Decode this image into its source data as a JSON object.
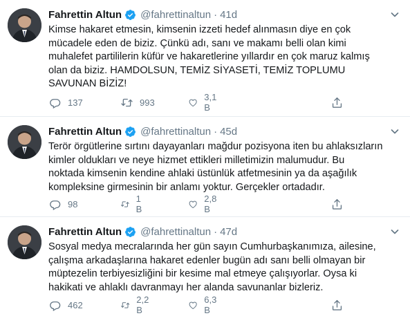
{
  "tweets": [
    {
      "author": "Fahrettin Altun",
      "handle": "@fahrettinaltun",
      "separator": "·",
      "time": "41d",
      "text": "Kimse hakaret etmesin, kimsenin izzeti hedef alınmasın diye en çok\nmücadele eden de biziz. Çünkü adı, sanı ve makamı belli olan kimi\nmuhalefet partililerin küfür ve hakaretlerine yıllardır en çok maruz kalmış\nolan da biziz. HAMDOLSUN, TEMİZ SİYASETİ, TEMİZ TOPLUMU\nSAVUNAN BİZİZ!",
      "replies": "137",
      "retweets": "993",
      "likes": "3,1 B"
    },
    {
      "author": "Fahrettin Altun",
      "handle": "@fahrettinaltun",
      "separator": "·",
      "time": "45d",
      "text": "Terör örgütlerine sırtını dayayanları mağdur pozisyona iten bu ahlaksızların\nkimler oldukları ve neye hizmet ettikleri milletimizin malumudur. Bu\nnoktada kimsenin kendine ahlaki üstünlük atfetmesinin ya da aşağılık\nkompleksine girmesinin bir anlamı yoktur. Gerçekler ortadadır.",
      "replies": "98",
      "retweets": "1 B",
      "likes": "2,8 B"
    },
    {
      "author": "Fahrettin Altun",
      "handle": "@fahrettinaltun",
      "separator": "·",
      "time": "47d",
      "text": "Sosyal medya mecralarında her gün sayın Cumhurbaşkanımıza, ailesine,\nçalışma arkadaşlarına hakaret edenler bugün adı sanı belli olmayan bir\nmüptezelin terbiyesizliğini bir kesime mal etmeye çalışıyorlar. Oysa ki\nhakikati ve ahlaklı davranmayı her alanda savunanlar bizleriz.",
      "replies": "462",
      "retweets": "2,2 B",
      "likes": "6,3 B"
    }
  ],
  "icons": {
    "reply": "reply-icon",
    "retweet": "retweet-icon",
    "like": "heart-icon",
    "share": "share-icon",
    "verified": "verified-badge-icon",
    "menu": "chevron-down-icon"
  },
  "colors": {
    "text": "#14171a",
    "secondary": "#657786",
    "verified": "#1da1f2",
    "divider": "#e6ecf0"
  }
}
